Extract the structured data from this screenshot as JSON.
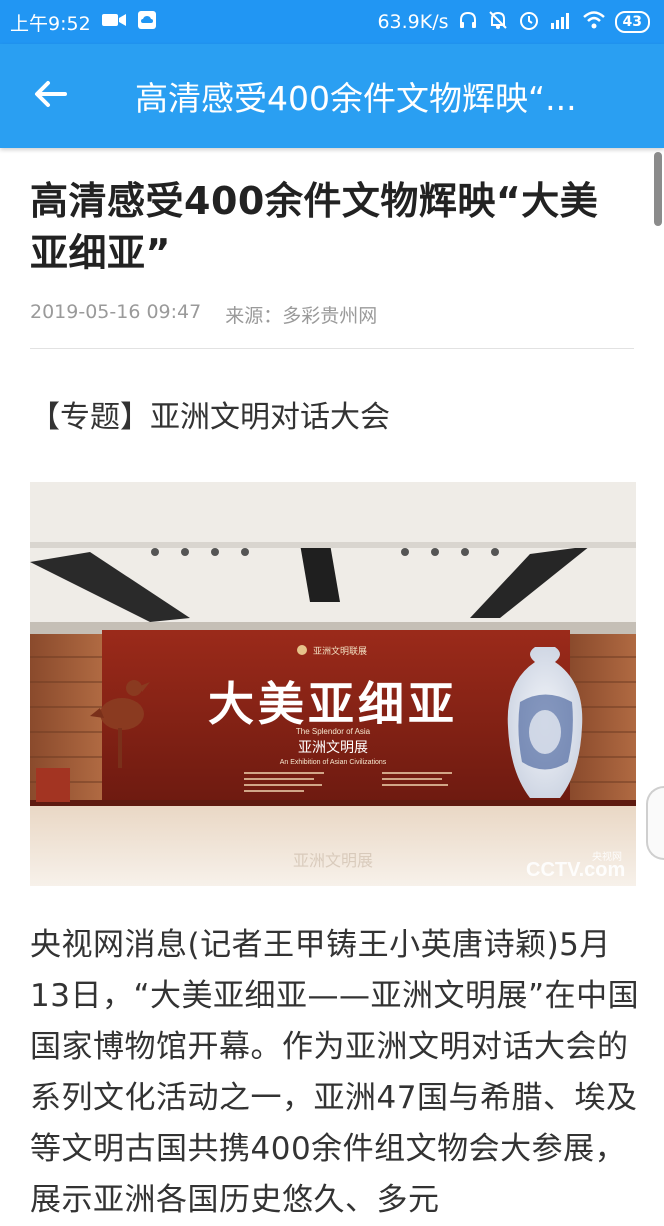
{
  "status_bar": {
    "time": "上午9:52",
    "net_speed": "63.9K/s",
    "battery": "43"
  },
  "app_bar": {
    "title": "高清感受400余件文物辉映“...",
    "back_icon": "arrow-left-icon"
  },
  "article": {
    "title": "高清感受400余件文物辉映“大美亚细亚”",
    "date": "2019-05-16 09:47",
    "source": "来源：多彩贵州网",
    "topic": "【专题】亚洲文明对话大会",
    "photo": {
      "calligraphy": "大美亚细亚",
      "subtitle_en": "The Splendor of Asia",
      "subtitle_cn": "亚洲文明展",
      "subtitle_en2": "An Exhibition of Asian Civilizations",
      "logo_text": "亚洲文明联展",
      "watermark": "CCTV.com",
      "watermark_cn": "央视网",
      "floor_reflection": "亚洲文明展"
    },
    "paragraph": "央视网消息(记者王甲铸王小英唐诗颖)5月13日，“大美亚细亚——亚洲文明展”在中国国家博物馆开幕。作为亚洲文明对话大会的系列文化活动之一，亚洲47国与希腊、埃及等文明古国共携400余件组文物会大参展，展示亚洲各国历史悠久、多元"
  }
}
